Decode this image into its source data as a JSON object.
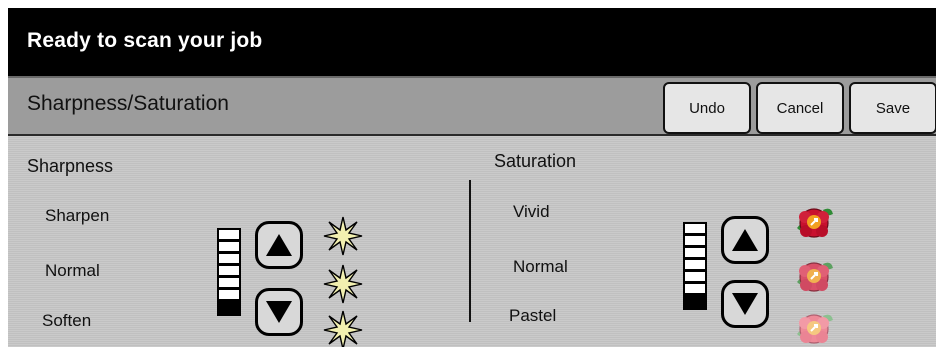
{
  "status": {
    "title": "Ready to scan your job"
  },
  "header": {
    "title": "Sharpness/Saturation"
  },
  "toolbar": {
    "undo_label": "Undo",
    "cancel_label": "Cancel",
    "save_label": "Save"
  },
  "sharpness": {
    "title": "Sharpness",
    "options": [
      "Sharpen",
      "Normal",
      "Soften"
    ],
    "level_fraction": 0.14,
    "up_icon": "up-arrow-icon",
    "down_icon": "down-arrow-icon",
    "indicator_icons": [
      "starburst-icon",
      "starburst-icon",
      "starburst-icon"
    ]
  },
  "saturation": {
    "title": "Saturation",
    "options": [
      "Vivid",
      "Normal",
      "Pastel"
    ],
    "level_fraction": 0.14,
    "up_icon": "up-arrow-icon",
    "down_icon": "down-arrow-icon",
    "indicator_icons": [
      "vivid-flower-icon",
      "normal-flower-icon",
      "pastel-flower-icon"
    ]
  },
  "colors": {
    "status_bar": "#000000",
    "header_bar": "#9c9c9c",
    "content": "#c6c6c6",
    "button_face": "#e6e6e6",
    "starburst": "#f2f0b0"
  }
}
